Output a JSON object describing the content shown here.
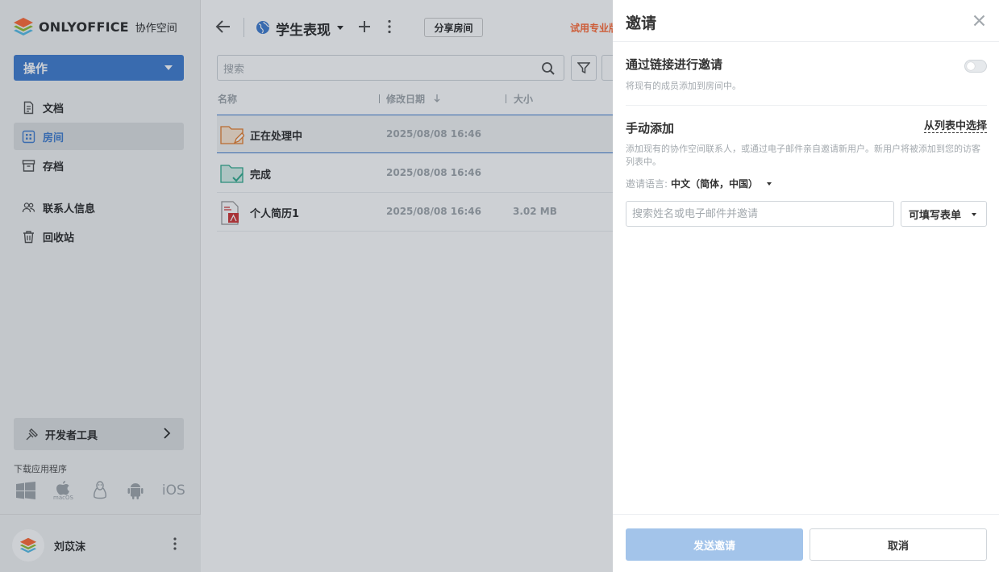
{
  "sidebar": {
    "logo": {
      "brand": "ONLYOFFICE",
      "product": "协作空间"
    },
    "action_label": "操作",
    "nav": [
      {
        "label": "文档",
        "icon": "document-icon"
      },
      {
        "label": "房间",
        "icon": "rooms-icon",
        "active": true
      },
      {
        "label": "存档",
        "icon": "archive-icon"
      },
      {
        "label": "联系人信息",
        "icon": "contacts-icon"
      },
      {
        "label": "回收站",
        "icon": "trash-icon"
      }
    ],
    "dev_tools_label": "开发者工具",
    "download_title": "下载应用程序",
    "download_apps": {
      "macos": "macOS",
      "ios": "iOS"
    },
    "user": {
      "name": "刘苡沫"
    }
  },
  "main": {
    "room_title": "学生表现",
    "share_label": "分享房间",
    "trial_label": "试用专业版",
    "search_placeholder": "搜索",
    "columns": {
      "name": "名称",
      "modified": "修改日期",
      "size": "大小"
    },
    "rows": [
      {
        "name": "正在处理中",
        "date": "2025/08/08 16:46",
        "size": "",
        "icon": "folder-edit-icon"
      },
      {
        "name": "完成",
        "date": "2025/08/08 16:46",
        "size": "",
        "icon": "folder-check-icon"
      },
      {
        "name": "个人简历1",
        "date": "2025/08/08 16:46",
        "size": "3.02 MB",
        "icon": "pdf-file-icon"
      }
    ]
  },
  "invite": {
    "title": "邀请",
    "link_title": "通过链接进行邀请",
    "link_desc": "将现有的成员添加到房间中。",
    "manual_title": "手动添加",
    "choose_from_list": "从列表中选择",
    "manual_desc": "添加现有的协作空间联系人，或通过电子邮件亲自邀请新用户。新用户将被添加到您的访客列表中。",
    "lang_label": "邀请语言:",
    "lang_value": "中文（简体，中国）",
    "input_placeholder": "搜索姓名或电子邮件并邀请",
    "role_value": "可填写表单",
    "send_label": "发送邀请",
    "cancel_label": "取消"
  },
  "colors": {
    "accent": "#4781d1",
    "trial": "#ff6f3d",
    "send_disabled": "#a3c4ea"
  }
}
